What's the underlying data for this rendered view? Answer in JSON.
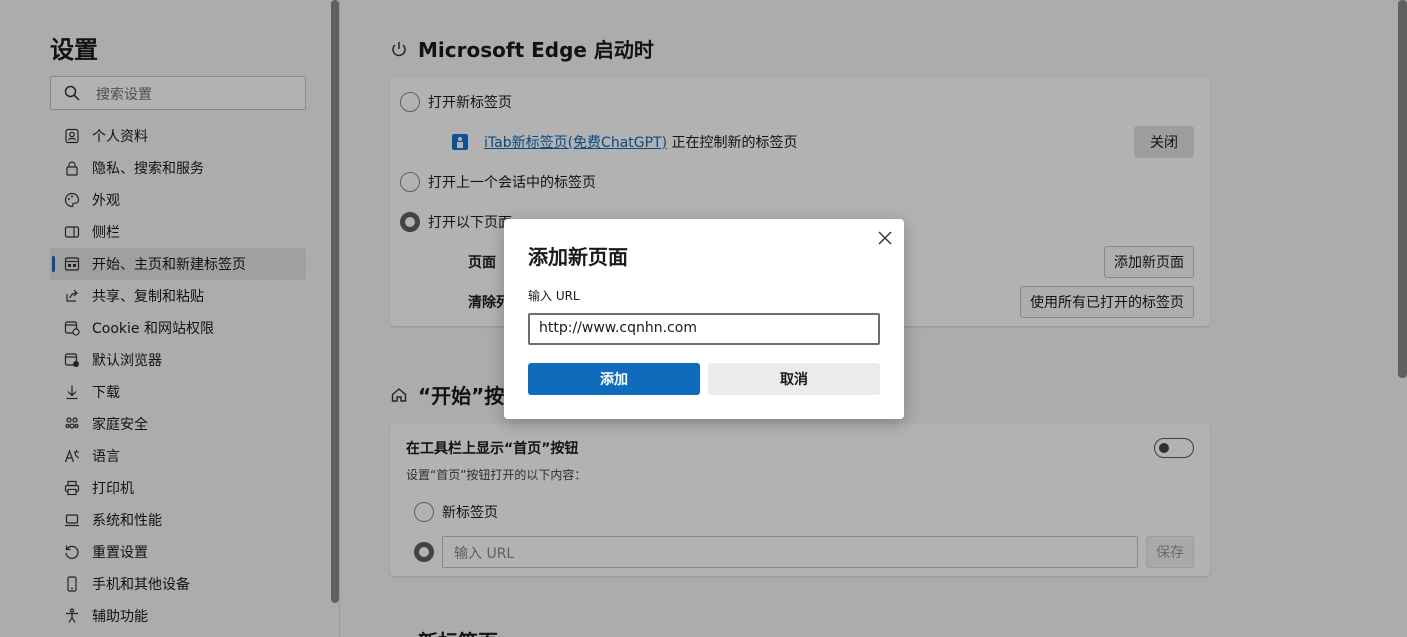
{
  "sidebar": {
    "title": "设置",
    "search_placeholder": "搜索设置",
    "items": [
      {
        "label": "个人资料",
        "icon": "profile-icon"
      },
      {
        "label": "隐私、搜索和服务",
        "icon": "lock-icon"
      },
      {
        "label": "外观",
        "icon": "palette-icon"
      },
      {
        "label": "侧栏",
        "icon": "sidebar-icon"
      },
      {
        "label": "开始、主页和新建标签页",
        "icon": "start-page-icon",
        "active": true
      },
      {
        "label": "共享、复制和粘贴",
        "icon": "share-icon"
      },
      {
        "label": "Cookie 和网站权限",
        "icon": "cookie-icon"
      },
      {
        "label": "默认浏览器",
        "icon": "browser-icon"
      },
      {
        "label": "下载",
        "icon": "download-icon"
      },
      {
        "label": "家庭安全",
        "icon": "family-icon"
      },
      {
        "label": "语言",
        "icon": "language-icon"
      },
      {
        "label": "打印机",
        "icon": "printer-icon"
      },
      {
        "label": "系统和性能",
        "icon": "laptop-icon"
      },
      {
        "label": "重置设置",
        "icon": "reset-icon"
      },
      {
        "label": "手机和其他设备",
        "icon": "phone-icon"
      },
      {
        "label": "辅助功能",
        "icon": "accessibility-icon"
      }
    ]
  },
  "startup": {
    "title": "Microsoft Edge 启动时",
    "option_new_tab": "打开新标签页",
    "extension_link": "iTab新标签页(免费ChatGPT)",
    "extension_text": "正在控制新的标签页",
    "close_button": "关闭",
    "option_prev_session": "打开上一个会话中的标签页",
    "option_pages": "打开以下页面",
    "pages_label": "页面",
    "add_page_button": "添加新页面",
    "clear_label": "清除列",
    "use_all_tabs_button": "使用所有已打开的标签页"
  },
  "home_button": {
    "title": "“开始”按钮",
    "show_label": "在工具栏上显示“首页”按钮",
    "sub_label": "设置“首页”按钮打开的以下内容：",
    "option_new_tab": "新标签页",
    "url_placeholder": "输入 URL",
    "save_button": "保存",
    "toggle_on": false
  },
  "next_section": {
    "title": "新标签页"
  },
  "dialog": {
    "title": "添加新页面",
    "url_label": "输入 URL",
    "url_value": "http://www.cqnhn.com",
    "add_button": "添加",
    "cancel_button": "取消"
  },
  "colors": {
    "accent": "#0f6cbd",
    "overlay": "rgba(0,0,0,0.30)"
  }
}
